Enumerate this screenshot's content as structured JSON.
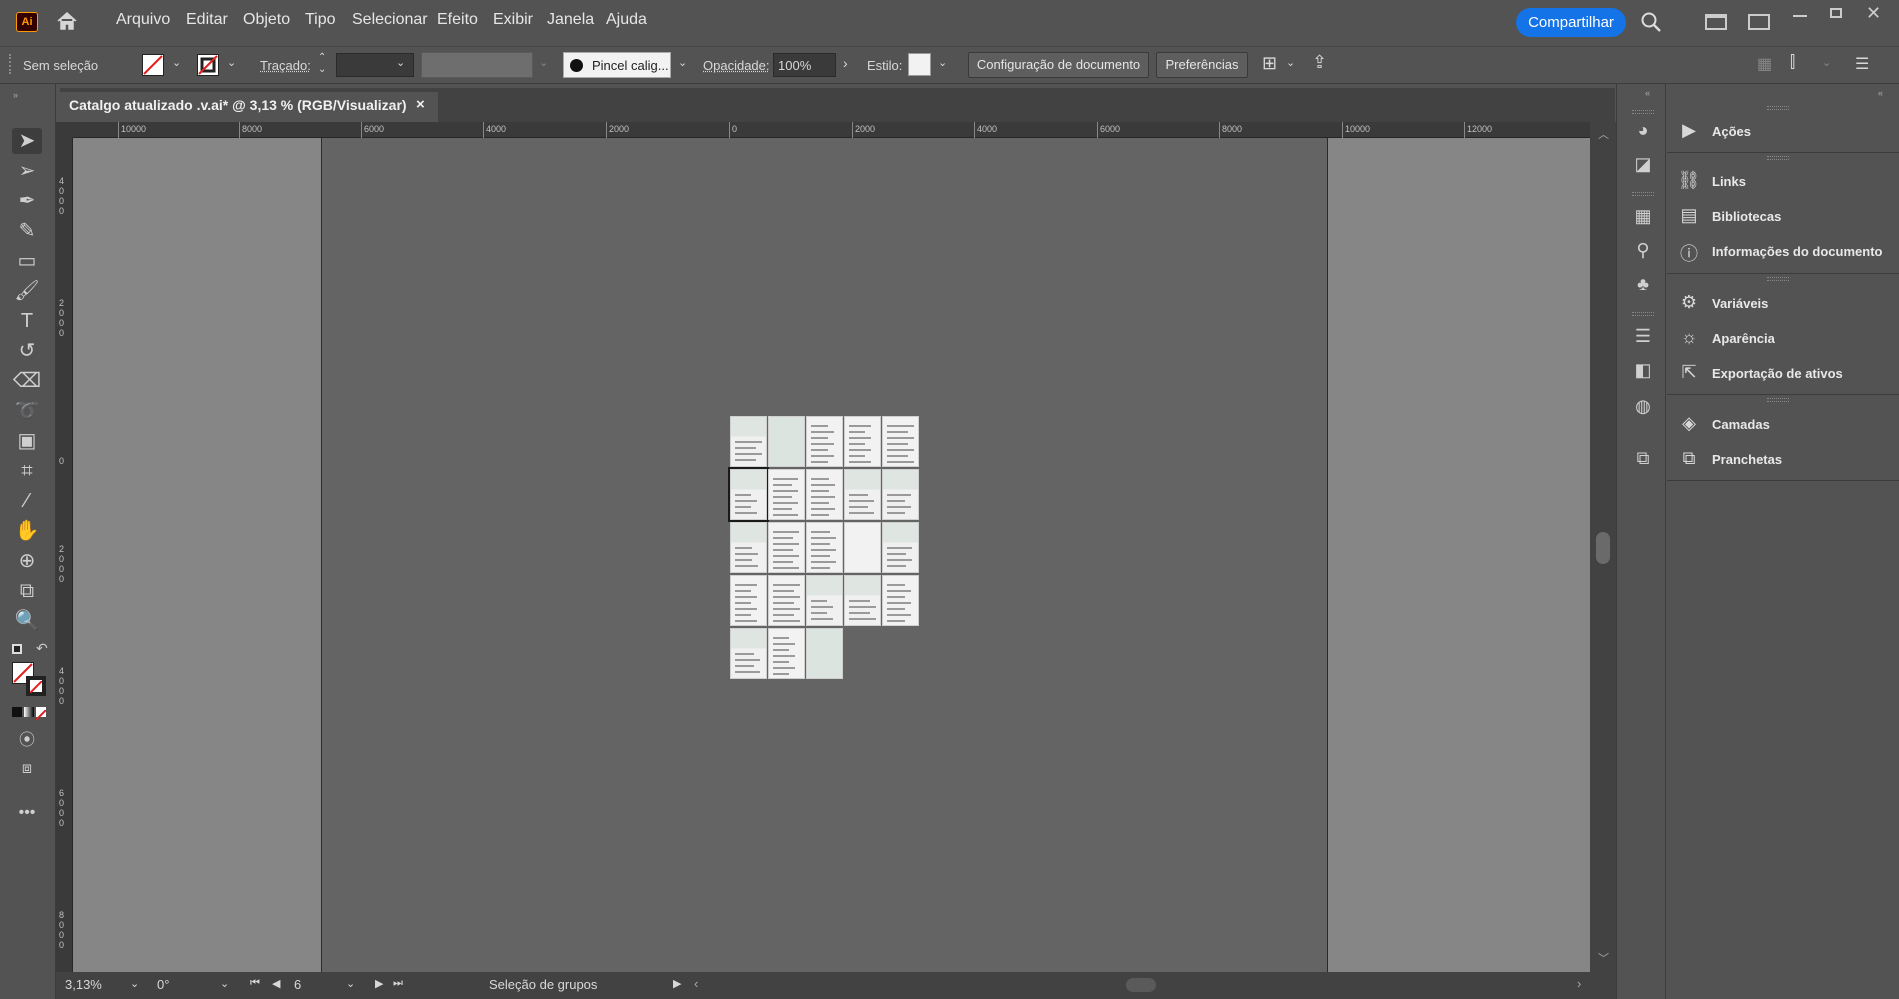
{
  "app": {
    "logo": "Ai",
    "home_icon": "home-icon"
  },
  "menu": [
    "Arquivo",
    "Editar",
    "Objeto",
    "Tipo",
    "Selecionar",
    "Efeito",
    "Exibir",
    "Janela",
    "Ajuda"
  ],
  "share_label": "Compartilhar",
  "control": {
    "selection": "Sem seleção",
    "stroke_label": "Traçado:",
    "brush": "Pincel calig...",
    "opacity_label": "Opacidade:",
    "opacity_value": "100%",
    "style_label": "Estilo:",
    "doc_setup": "Configuração de documento",
    "prefs": "Preferências"
  },
  "tab": {
    "title": "Catalgo atualizado .v.ai* @ 3,13 % (RGB/Visualizar)",
    "close": "×"
  },
  "ruler_top": [
    "10000",
    "8000",
    "6000",
    "4000",
    "2000",
    "0",
    "2000",
    "4000",
    "6000",
    "8000",
    "10000",
    "12000"
  ],
  "ruler_left": [
    "4000",
    "2000",
    "0",
    "2000",
    "4000",
    "6000",
    "8000"
  ],
  "status": {
    "zoom": "3,13%",
    "rotation": "0°",
    "artboard": "6",
    "mode": "Seleção de grupos"
  },
  "panels": [
    {
      "label": "Ações",
      "icon": "play-icon"
    },
    {
      "label": "Links",
      "icon": "link-icon"
    },
    {
      "label": "Bibliotecas",
      "icon": "library-icon"
    },
    {
      "label": "Informações do documento",
      "icon": "doc-info-icon"
    },
    {
      "label": "Variáveis",
      "icon": "variables-icon"
    },
    {
      "label": "Aparência",
      "icon": "appearance-icon"
    },
    {
      "label": "Exportação de ativos",
      "icon": "asset-export-icon"
    },
    {
      "label": "Camadas",
      "icon": "layers-icon"
    },
    {
      "label": "Pranchetas",
      "icon": "artboards-icon"
    }
  ],
  "colors": {
    "accent": "#1473e6",
    "canvas": "#646464",
    "pasteboard": "#868686"
  }
}
